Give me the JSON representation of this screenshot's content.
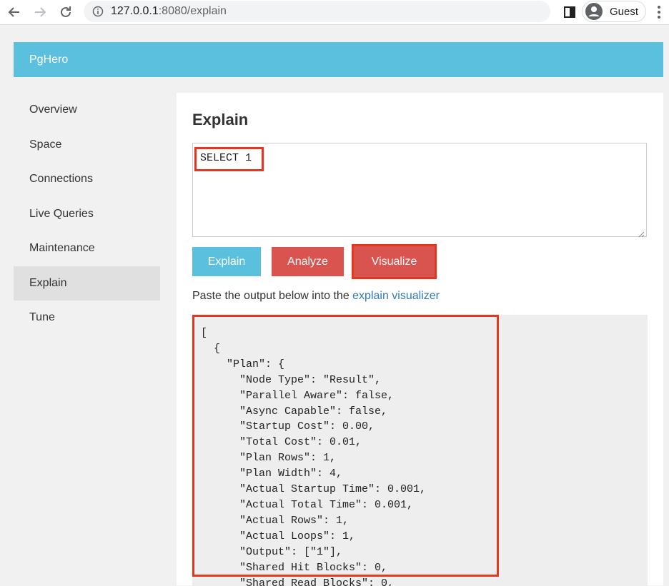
{
  "browser": {
    "url_host": "127.0.0.1",
    "url_rest": ":8080/explain",
    "profile_label": "Guest"
  },
  "app": {
    "brand": "PgHero"
  },
  "sidebar": {
    "items": [
      {
        "label": "Overview"
      },
      {
        "label": "Space"
      },
      {
        "label": "Connections"
      },
      {
        "label": "Live Queries"
      },
      {
        "label": "Maintenance"
      },
      {
        "label": "Explain",
        "active": true
      },
      {
        "label": "Tune"
      }
    ]
  },
  "main": {
    "title": "Explain",
    "query": "SELECT 1",
    "buttons": {
      "explain": "Explain",
      "analyze": "Analyze",
      "visualize": "Visualize"
    },
    "hint_prefix": "Paste the output below into the ",
    "hint_link": "explain visualizer",
    "output_lines": [
      "[",
      "  {",
      "    \"Plan\": {",
      "      \"Node Type\": \"Result\",",
      "      \"Parallel Aware\": false,",
      "      \"Async Capable\": false,",
      "      \"Startup Cost\": 0.00,",
      "      \"Total Cost\": 0.01,",
      "      \"Plan Rows\": 1,",
      "      \"Plan Width\": 4,",
      "      \"Actual Startup Time\": 0.001,",
      "      \"Actual Total Time\": 0.001,",
      "      \"Actual Rows\": 1,",
      "      \"Actual Loops\": 1,",
      "      \"Output\": [\"1\"],",
      "      \"Shared Hit Blocks\": 0,",
      "      \"Shared Read Blocks\": 0,"
    ]
  },
  "colors": {
    "header": "#5bc0de",
    "explain_button": "#5bc0de",
    "danger_button": "#d9534f",
    "highlight": "#e8351d",
    "link": "#337ab7"
  }
}
